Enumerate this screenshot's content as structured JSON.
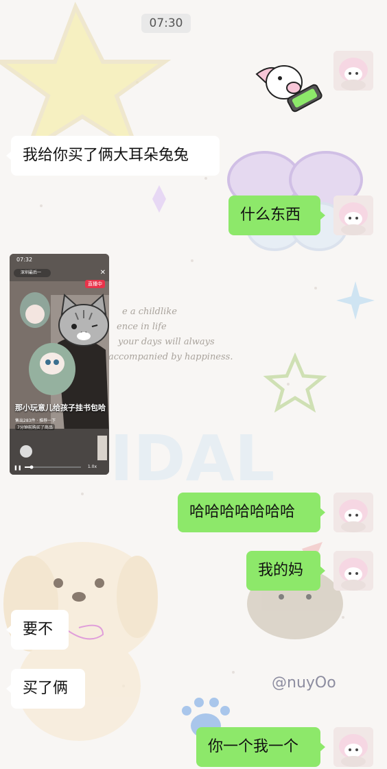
{
  "time": "07:30",
  "messages": [
    {
      "side": "in",
      "text": "我给你买了俩大耳朵兔兔"
    },
    {
      "side": "out",
      "text": "什么东西"
    },
    {
      "side": "out",
      "text": "哈哈哈哈哈哈哈"
    },
    {
      "side": "out",
      "text": "我的妈"
    },
    {
      "side": "in",
      "text": "要不"
    },
    {
      "side": "in",
      "text": "买了俩"
    },
    {
      "side": "out",
      "text": "你一个我一个"
    }
  ],
  "shared_screenshot": {
    "status_time": "07:32",
    "account": "深圳最后一",
    "live_badge": "直播中",
    "caption": "那小玩意儿给孩子挂书包哈",
    "sold_line": "售出283件 · 推荐一下",
    "recent_purchase": "7分钟前购买了商品",
    "speed": "1.0x"
  },
  "background_text": {
    "quote_lines": [
      "e a childlike",
      "ence in life",
      "your days will always",
      "accompanied by happiness."
    ],
    "watermark": "@nuyOo",
    "big_letters": "IDAL"
  },
  "colors": {
    "outgoing_bubble": "#8de86a",
    "incoming_bubble": "#ffffff"
  }
}
